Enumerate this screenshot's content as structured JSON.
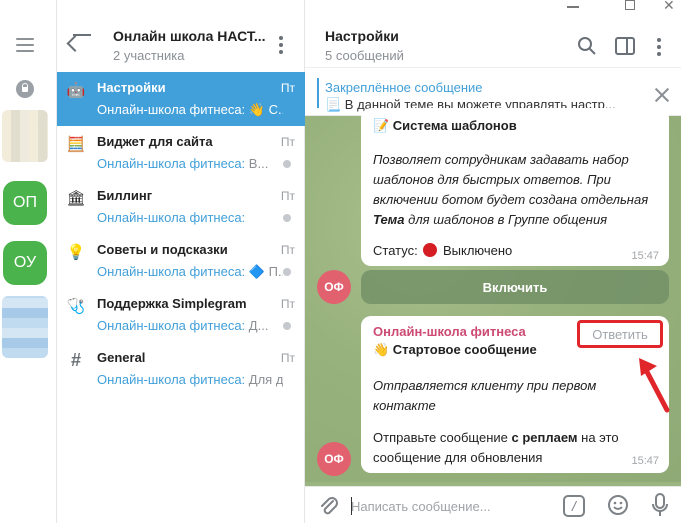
{
  "rail": {
    "folders": [
      {
        "label": "ОП",
        "color": "#4bb34b"
      },
      {
        "label": "ОУ",
        "color": "#4bb34b"
      }
    ]
  },
  "sidebar": {
    "title": "Онлайн школа НАСТ...",
    "subtitle": "2 участника",
    "topics": [
      {
        "icon": "🤖",
        "icon_name": "robot-icon",
        "name": "Настройки",
        "date": "Пт",
        "preview_sender": "Онлайн-школа фитнеса: ",
        "preview_text": "👋 С...",
        "active": true,
        "dot": false
      },
      {
        "icon": "🧮",
        "icon_name": "abacus-icon",
        "name": "Виджет для сайта",
        "date": "Пт",
        "preview_sender": "Онлайн-школа фитнеса: ",
        "preview_text": "В...",
        "active": false,
        "dot": true
      },
      {
        "icon": "🏛",
        "icon_name": "bank-icon",
        "name": "Биллинг",
        "date": "Пт",
        "preview_sender": "Онлайн-школа фитнеса: ",
        "preview_text": "",
        "active": false,
        "dot": true
      },
      {
        "icon": "💡",
        "icon_name": "lightbulb-icon",
        "name": "Советы и подсказки",
        "date": "Пт",
        "preview_sender": "Онлайн-школа фитнеса: ",
        "preview_text": "🔷 П...",
        "active": false,
        "dot": true
      },
      {
        "icon": "🩺",
        "icon_name": "stethoscope-icon",
        "name": "Поддержка Simplegram",
        "date": "Пт",
        "preview_sender": "Онлайн-школа фитнеса: ",
        "preview_text": "Д...",
        "active": false,
        "dot": true
      },
      {
        "icon": "#",
        "icon_name": "hash-icon",
        "name": "General",
        "date": "Пт",
        "preview_sender": "Онлайн-школа фитнеса: ",
        "preview_text": "Для д...",
        "active": false,
        "dot": false
      }
    ]
  },
  "chat": {
    "title": "Настройки",
    "subtitle": "5 сообщений",
    "pinned": {
      "label": "Закреплённое сообщение",
      "text": "📃 В данной теме вы можете управлять настр..."
    },
    "message1": {
      "title": "📝 Система шаблонов",
      "lines": [
        "Позволяет сотрудникам задавать набор",
        "шаблонов для быстрых ответов. При",
        "включении ботом будет создана отдельная"
      ],
      "line4_bold": "Тема",
      "line4_rest": " для шаблонов в Группе общения",
      "status_label": "Статус:",
      "status_value": "Выключено",
      "time": "15:47",
      "button": "Включить"
    },
    "message2": {
      "sender": "Онлайн-школа фитнеса",
      "reply": "Ответить",
      "title": "👋 Стартовое сообщение",
      "lines": [
        "Отправляется клиенту при первом",
        "контакте"
      ],
      "line3_pre": "Отправьте сообщение ",
      "line3_bold": "с реплаем",
      "line3_post": " на это",
      "line4": "сообщение для обновления",
      "time": "15:47"
    },
    "avatar_initials": "ОФ",
    "composer_placeholder": "Написать сообщение..."
  }
}
